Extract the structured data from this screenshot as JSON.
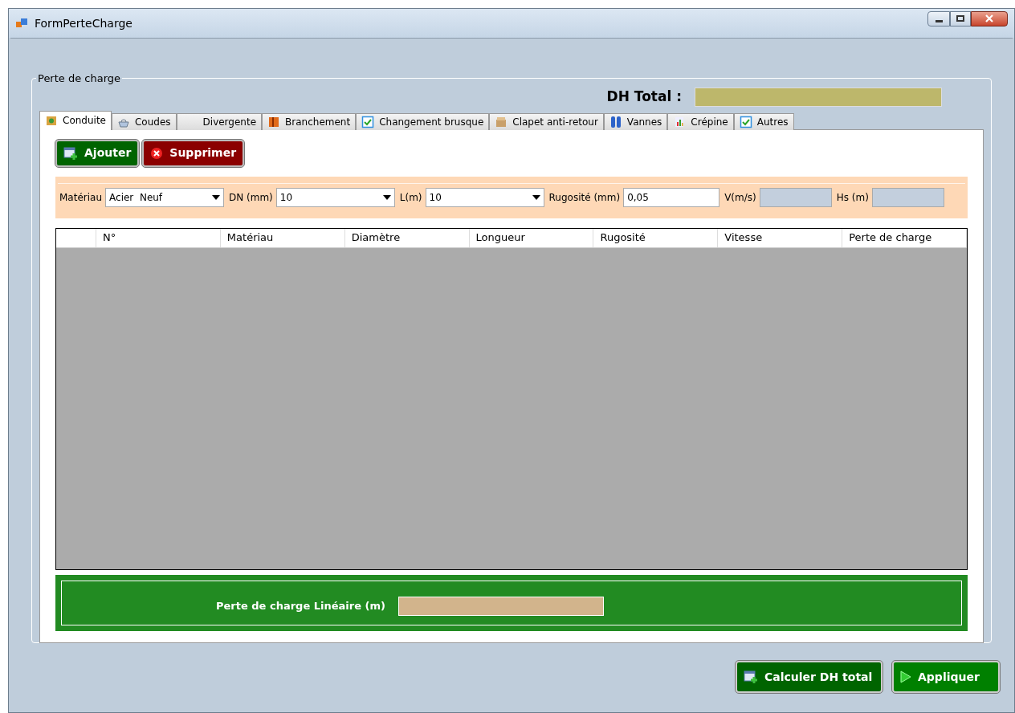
{
  "window": {
    "title": "FormPerteCharge"
  },
  "group": {
    "title": "Perte de charge"
  },
  "dh_total": {
    "label": "DH Total :"
  },
  "tabs": [
    {
      "label": "Conduite",
      "selected": true
    },
    {
      "label": "Coudes",
      "selected": false
    },
    {
      "label": "Divergente",
      "selected": false
    },
    {
      "label": "Branchement",
      "selected": false
    },
    {
      "label": "Changement brusque",
      "selected": false
    },
    {
      "label": "Clapet anti-retour",
      "selected": false
    },
    {
      "label": "Vannes",
      "selected": false
    },
    {
      "label": "Crépine",
      "selected": false
    },
    {
      "label": "Autres",
      "selected": false
    }
  ],
  "actions": [
    {
      "label": "Ajouter",
      "kind": "add"
    },
    {
      "label": "Supprimer",
      "kind": "delete"
    }
  ],
  "inputs": [
    {
      "label": "Matériau",
      "kind": "dropdown",
      "value": "Acier  Neuf"
    },
    {
      "label": "DN (mm)",
      "kind": "dropdown",
      "value": "10"
    },
    {
      "label": "L(m)",
      "kind": "dropdown",
      "value": "10"
    },
    {
      "label": "Rugosité (mm)",
      "kind": "text",
      "value": "0,05"
    },
    {
      "label": "V(m/s)",
      "kind": "readonly"
    },
    {
      "label": "Hs (m)",
      "kind": "readonly"
    }
  ],
  "table": {
    "columns": [
      "N°",
      "Matériau",
      "Diamètre",
      "Longueur",
      "Rugosité",
      "Vitesse",
      "Perte de charge"
    ]
  },
  "linear_loss": {
    "label": "Perte de charge Linéaire (m)"
  },
  "footer_buttons": [
    {
      "label": "Calculer DH total",
      "kind": "calc"
    },
    {
      "label": "Appliquer",
      "kind": "apply"
    }
  ]
}
